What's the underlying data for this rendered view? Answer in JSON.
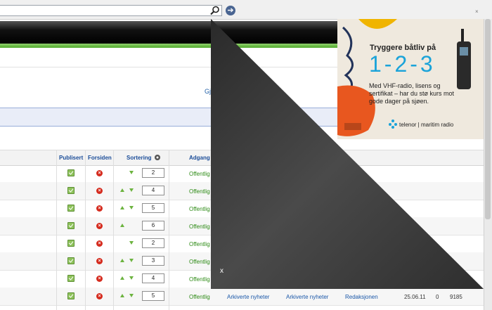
{
  "corner_close": "×",
  "overlay_close": "x",
  "toolbar_link": "Gj",
  "columns": {
    "published": "Publisert",
    "frontpage": "Forsiden",
    "sorting": "Sortering",
    "access": "Adgang"
  },
  "rows": [
    {
      "order": "2",
      "up": false,
      "down": true,
      "access": "Offentlig"
    },
    {
      "order": "4",
      "up": true,
      "down": true,
      "access": "Offentlig"
    },
    {
      "order": "5",
      "up": true,
      "down": true,
      "access": "Offentlig"
    },
    {
      "order": "6",
      "up": true,
      "down": false,
      "access": "Offentlig"
    },
    {
      "order": "2",
      "up": false,
      "down": true,
      "access": "Offentlig"
    },
    {
      "order": "3",
      "up": true,
      "down": true,
      "access": "Offentlig"
    },
    {
      "order": "4",
      "up": true,
      "down": true,
      "access": "Offentlig"
    },
    {
      "order": "5",
      "up": true,
      "down": true,
      "access": "Offentlig",
      "section": "Arkiverte nyheter",
      "category": "Arkiverte nyheter",
      "author": "Redaksjonen",
      "date": "25.06.11",
      "hits": "0",
      "id": "9185"
    }
  ],
  "ad": {
    "headline": "Tryggere båtliv på",
    "big": "1-2-3",
    "body": "Med VHF-radio, lisens og sertifikat – har du stø kurs mot gode dager på sjøen.",
    "brand": "telenor | maritim radio"
  },
  "colors": {
    "accent": "#1a4c98",
    "green": "#6cb33f",
    "overlay": "#3c3c3c"
  }
}
